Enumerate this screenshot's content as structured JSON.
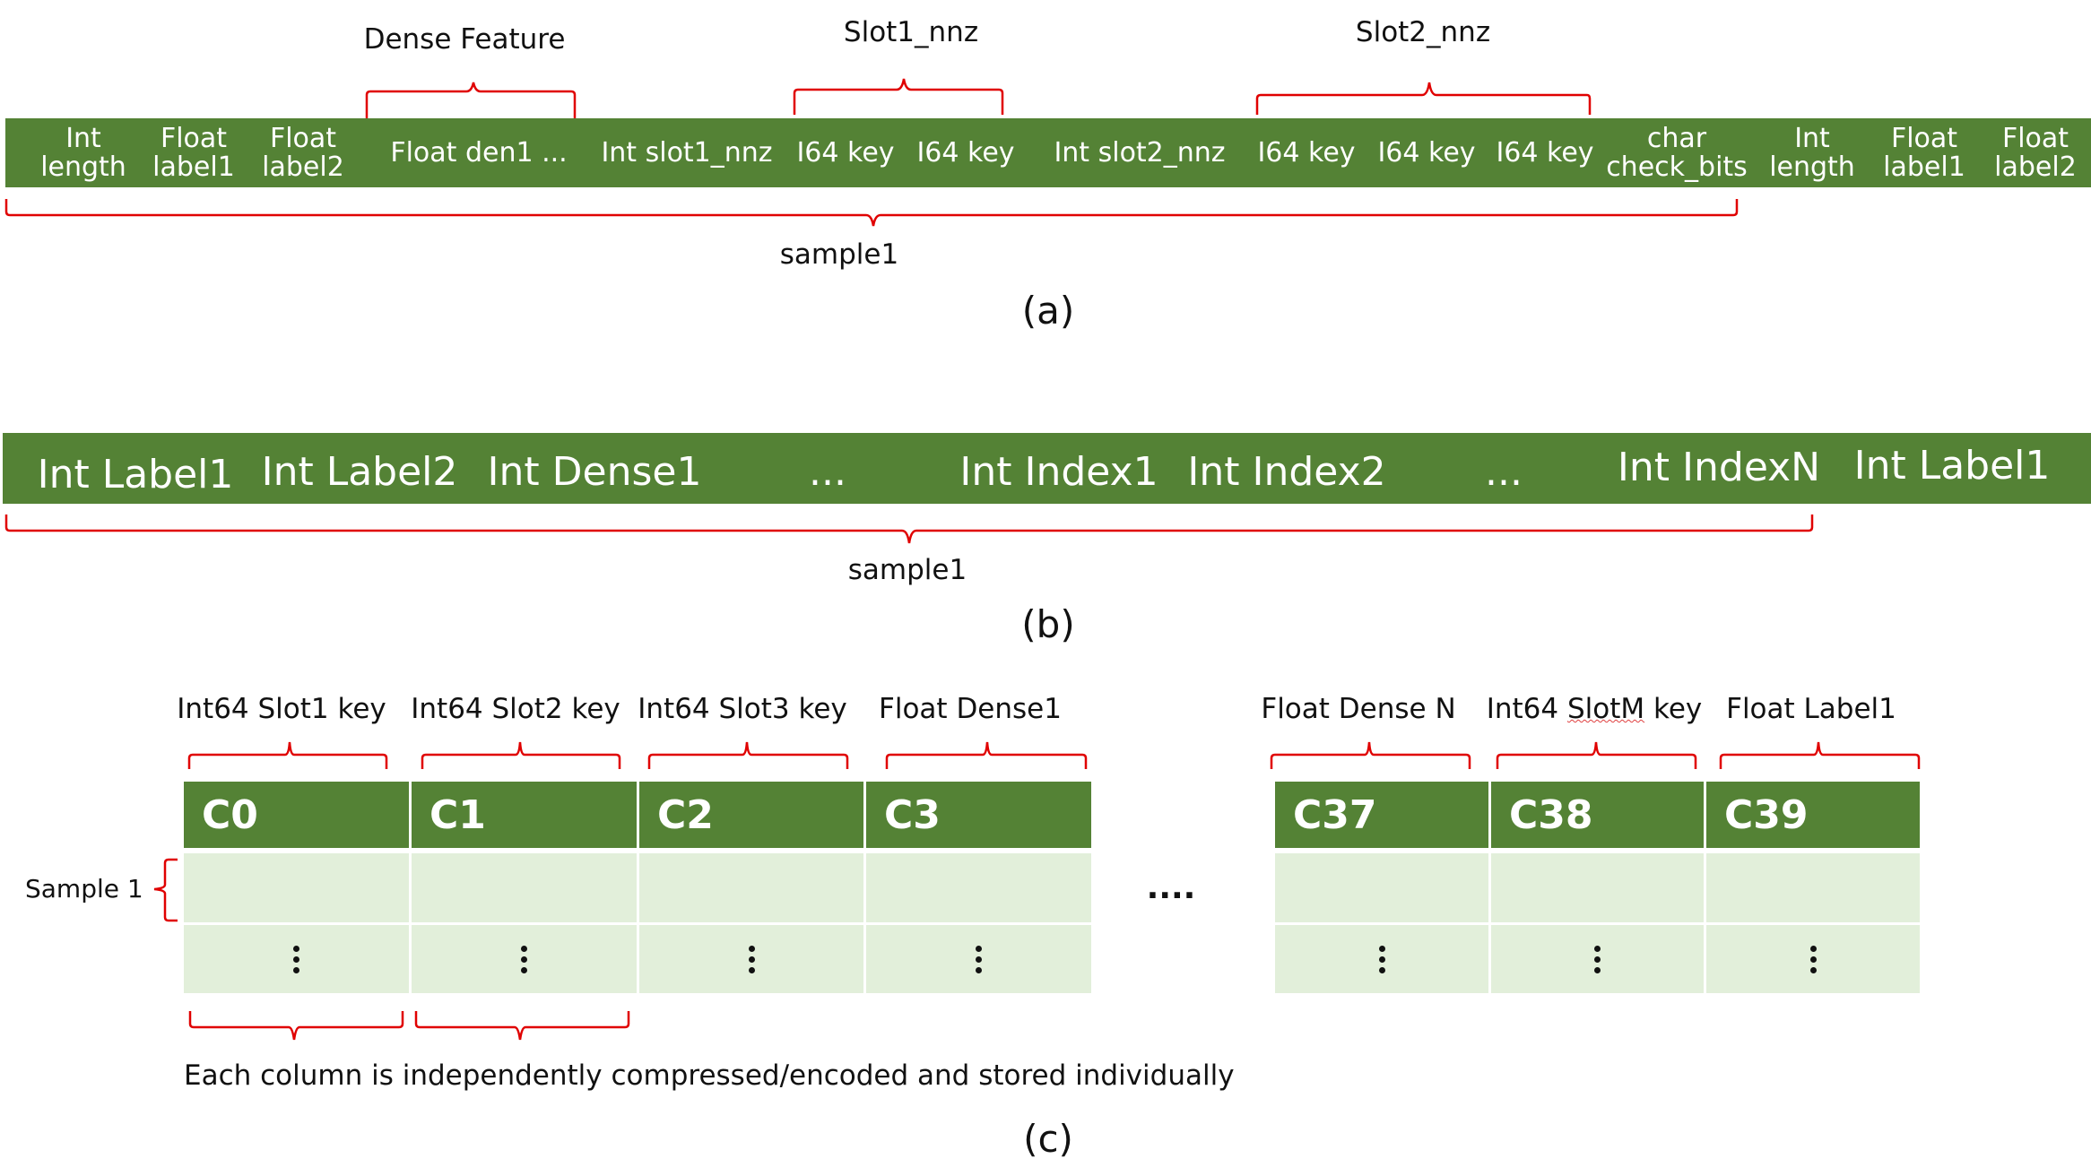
{
  "panel_a": {
    "caption": "(a)",
    "cells": [
      {
        "line1": "Int",
        "line2": "length"
      },
      {
        "line1": "Float",
        "line2": "label1"
      },
      {
        "line1": "Float",
        "line2": "label2"
      },
      {
        "line1": "Float den1 ...",
        "line2": ""
      },
      {
        "line1": "Int slot1_nnz",
        "line2": ""
      },
      {
        "line1": "I64 key",
        "line2": ""
      },
      {
        "line1": "I64 key",
        "line2": ""
      },
      {
        "line1": "Int slot2_nnz",
        "line2": ""
      },
      {
        "line1": "I64 key",
        "line2": ""
      },
      {
        "line1": "I64 key",
        "line2": ""
      },
      {
        "line1": "I64 key",
        "line2": ""
      },
      {
        "line1": "char",
        "line2": "check_bits"
      },
      {
        "line1": "Int",
        "line2": "length"
      },
      {
        "line1": "Float",
        "line2": "label1"
      },
      {
        "line1": "Float",
        "line2": "label2"
      }
    ],
    "group_labels": {
      "dense_feature": "Dense Feature",
      "slot1_nnz": "Slot1_nnz",
      "slot2_nnz": "Slot2_nnz",
      "sample": "sample1"
    }
  },
  "panel_b": {
    "caption": "(b)",
    "cells": [
      "Int Label1",
      "Int Label2",
      "Int Dense1",
      "...",
      "Int Index1",
      "Int Index2",
      "...",
      "Int IndexN",
      "Int Label1"
    ],
    "sample_label": "sample1"
  },
  "panel_c": {
    "caption": "(c)",
    "left_columns": [
      {
        "header": "C0",
        "label": "Int64 Slot1 key"
      },
      {
        "header": "C1",
        "label": "Int64 Slot2 key"
      },
      {
        "header": "C2",
        "label": "Int64 Slot3 key"
      },
      {
        "header": "C3",
        "label": "Float Dense1"
      }
    ],
    "right_columns": [
      {
        "header": "C37",
        "label": "Float Dense N"
      },
      {
        "header": "C38",
        "label_pre": "Int64 ",
        "label_mark": "SlotM",
        "label_post": " key"
      },
      {
        "header": "C39",
        "label": "Float Label1"
      }
    ],
    "row_label": "Sample 1",
    "gap_ellipsis": "....",
    "footnote": "Each column is independently compressed/encoded and stored individually"
  },
  "colors": {
    "bar_green": "#548235",
    "row_light_green": "#E2EFDA",
    "brace_red": "#E00000",
    "text_white": "#FFFFFF"
  }
}
